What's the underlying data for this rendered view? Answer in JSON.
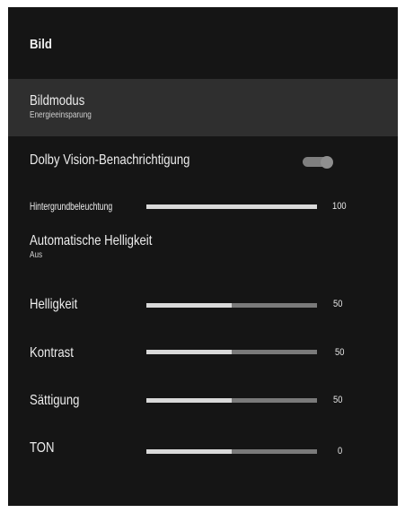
{
  "header": {
    "title": "Bild"
  },
  "picture_mode": {
    "label": "Bildmodus",
    "value": "Energieeinsparung"
  },
  "dolby_vision": {
    "label": "Dolby Vision-Benachrichtigung",
    "enabled": true
  },
  "backlight": {
    "label": "Hintergrundbeleuchtung",
    "value": "100",
    "level": 1.0
  },
  "auto_brightness": {
    "label": "Automatische Helligkeit",
    "value": "Aus"
  },
  "brightness": {
    "label": "Helligkeit",
    "value": "50",
    "level": 0.5
  },
  "contrast": {
    "label": "Kontrast",
    "value": "50",
    "level": 0.5
  },
  "saturation": {
    "label": "Sättigung",
    "value": "50",
    "level": 0.5
  },
  "tone": {
    "label": "TON",
    "value": "0",
    "level": 0.5
  },
  "colors": {
    "panel": "#151515",
    "selected_row": "#2f2f2f",
    "bar_fill": "#d9d9d9",
    "bar_track": "#7a7a7a"
  }
}
